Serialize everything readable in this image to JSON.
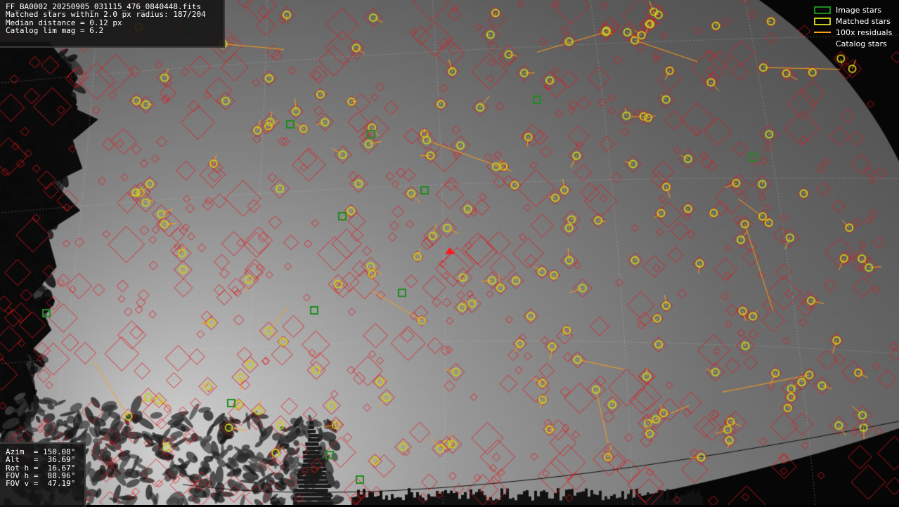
{
  "info": {
    "filename": "FF_BA0002_20250905_031115_476_0840448.fits",
    "matched_line": "Matched stars within 2.0 px radius: 187/204",
    "median_line": "Median distance = 0.12 px",
    "catalog_line": "Catalog lim mag = 6.2"
  },
  "pointing": {
    "azim": "Azim  = 150.08°",
    "alt": "Alt   =  36.69°",
    "rot": "Rot h =  16.67°",
    "fov_h": "FOV h =  88.96°",
    "fov_v": "FOV v =  47.19°"
  },
  "legend": {
    "image_stars": "Image stars",
    "matched_stars": "Matched stars",
    "residuals": "100x residuals",
    "catalog_stars": "Catalog stars"
  },
  "colors": {
    "image_star": "#1f8a1f",
    "matched_star": "#c8cc1e",
    "residual": "#ff9d16",
    "catalog_star": "#e0161c",
    "grid": "#d6d6d6"
  }
}
